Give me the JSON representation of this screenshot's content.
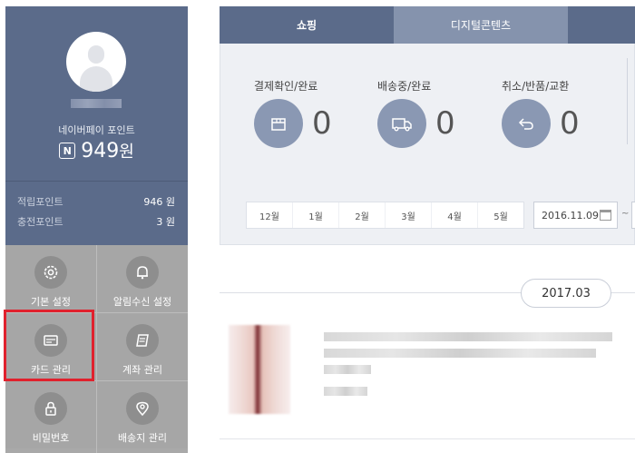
{
  "sidebar": {
    "pay_label": "네이버페이 포인트",
    "pay_amount": "949",
    "pay_unit": "원",
    "n_badge": "N",
    "points": [
      {
        "label": "적립포인트",
        "value": "946 원"
      },
      {
        "label": "충전포인트",
        "value": "3 원"
      }
    ],
    "menu": [
      {
        "label": "기본 설정",
        "icon": "gear-icon"
      },
      {
        "label": "알림수신 설정",
        "icon": "bell-icon"
      },
      {
        "label": "카드 관리",
        "icon": "card-icon"
      },
      {
        "label": "계좌 관리",
        "icon": "account-icon"
      },
      {
        "label": "비밀번호",
        "icon": "lock-icon"
      },
      {
        "label": "배송지 관리",
        "icon": "location-pin-icon"
      }
    ]
  },
  "tabs": [
    {
      "label": "쇼핑",
      "active": true
    },
    {
      "label": "디지털콘텐츠",
      "active": false
    }
  ],
  "status": [
    {
      "label": "결제확인/완료",
      "count": "0",
      "icon": "box-icon"
    },
    {
      "label": "배송중/완료",
      "count": "0",
      "icon": "truck-icon"
    },
    {
      "label": "취소/반품/교환",
      "count": "0",
      "icon": "return-arrow-icon"
    }
  ],
  "months": [
    "12월",
    "1월",
    "2월",
    "3월",
    "4월",
    "5월"
  ],
  "date_from": "2016.11.09",
  "date_separator": "~",
  "order_date": "2017.03",
  "colors": {
    "sidebar_bg": "#5b6b8a",
    "menu_bg": "#a6a6a6",
    "highlight": "#e0212d",
    "status_circle": "#8a98b3"
  }
}
